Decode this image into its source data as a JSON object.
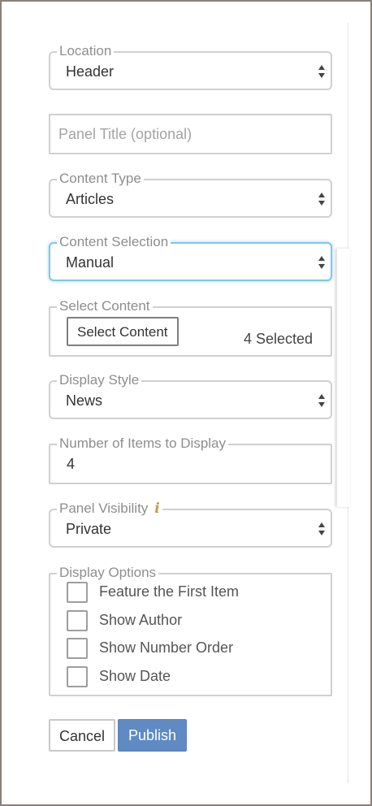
{
  "location": {
    "legend": "Location",
    "value": "Header"
  },
  "panel_title": {
    "placeholder": "Panel Title (optional)"
  },
  "content_type": {
    "legend": "Content Type",
    "value": "Articles"
  },
  "content_selection": {
    "legend": "Content Selection",
    "value": "Manual"
  },
  "select_content": {
    "legend": "Select Content",
    "button_label": "Select Content",
    "count_text": "4 Selected"
  },
  "display_style": {
    "legend": "Display Style",
    "value": "News"
  },
  "items_to_display": {
    "legend": "Number of Items to Display",
    "value": "4"
  },
  "visibility": {
    "legend": "Panel Visibility",
    "info_icon": "i",
    "value": "Private"
  },
  "display_options": {
    "legend": "Display Options",
    "options": [
      {
        "label": "Feature the First Item",
        "checked": false
      },
      {
        "label": "Show Author",
        "checked": false
      },
      {
        "label": "Show Number Order",
        "checked": false
      },
      {
        "label": "Show Date",
        "checked": false
      }
    ]
  },
  "actions": {
    "cancel_label": "Cancel",
    "publish_label": "Publish"
  },
  "colors": {
    "focus_border": "#7ec8ee",
    "publish_bg": "#5f8ac4",
    "info_icon": "#c9974a"
  }
}
